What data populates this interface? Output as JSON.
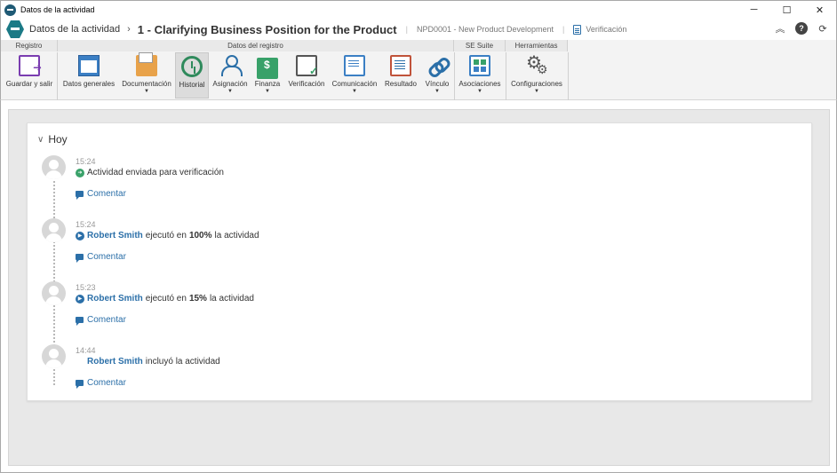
{
  "window": {
    "title": "Datos de la actividad",
    "controls": {
      "minimize": "─",
      "maximize": "☐",
      "close": "✕"
    }
  },
  "header": {
    "breadcrumb_root": "Datos de la actividad",
    "breadcrumb_sep": "›",
    "activity_title": "1 - Clarifying Business Position for the Product",
    "project": "NPD0001 - New Product Development",
    "pipe": "|",
    "status": "Verificación",
    "icons": [
      "collapse-icon",
      "help-icon",
      "refresh-icon"
    ]
  },
  "ribbon": {
    "groups": [
      {
        "label": "Registro"
      },
      {
        "label": "Datos del registro"
      },
      {
        "label": "SE Suite"
      },
      {
        "label": "Herramientas"
      }
    ],
    "buttons": [
      {
        "label": "Guardar y salir",
        "icon": "save-exit-icon",
        "dropdown": false
      },
      {
        "label": "Datos generales",
        "icon": "general-data-icon",
        "dropdown": false
      },
      {
        "label": "Documentación",
        "icon": "folder-icon",
        "dropdown": true
      },
      {
        "label": "Historial",
        "icon": "history-icon",
        "dropdown": false,
        "active": true
      },
      {
        "label": "Asignación",
        "icon": "users-icon",
        "dropdown": true
      },
      {
        "label": "Finanza",
        "icon": "money-icon",
        "dropdown": true
      },
      {
        "label": "Verificación",
        "icon": "checklist-icon",
        "dropdown": false
      },
      {
        "label": "Comunicación",
        "icon": "message-icon",
        "dropdown": true
      },
      {
        "label": "Resultado",
        "icon": "result-icon",
        "dropdown": false
      },
      {
        "label": "Vínculo",
        "icon": "link-icon",
        "dropdown": true
      },
      {
        "label": "Asociaciones",
        "icon": "associations-icon",
        "dropdown": true
      },
      {
        "label": "Configuraciones",
        "icon": "gears-icon",
        "dropdown": true
      }
    ],
    "caret": "▼"
  },
  "timeline": {
    "section_label": "Hoy",
    "chevron": "∨",
    "comment_label": "Comentar",
    "entries": [
      {
        "time": "15:24",
        "status": "green",
        "status_glyph": "➜",
        "user": "",
        "text_before": "Actividad enviada para verificación",
        "value": "",
        "text_after": ""
      },
      {
        "time": "15:24",
        "status": "blue",
        "status_glyph": "▶",
        "user": "Robert Smith",
        "text_before": "ejecutó en",
        "value": "100%",
        "text_after": "la actividad"
      },
      {
        "time": "15:23",
        "status": "blue",
        "status_glyph": "▶",
        "user": "Robert Smith",
        "text_before": "ejecutó en",
        "value": "15%",
        "text_after": "la actividad"
      },
      {
        "time": "14:44",
        "status": "none",
        "status_glyph": "",
        "user": "Robert Smith",
        "text_before": "incluyó la actividad",
        "value": "",
        "text_after": ""
      }
    ]
  }
}
